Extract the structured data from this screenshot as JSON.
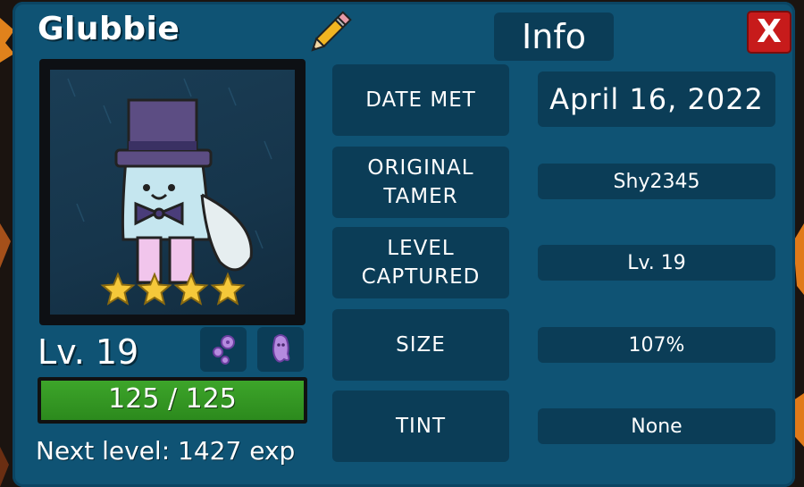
{
  "pet": {
    "name": "Glubbie",
    "level": "Lv. 19",
    "stars": 4,
    "hp": {
      "text": "125 / 125",
      "fraction": 1.0
    },
    "next_level": "Next level: 1427 exp"
  },
  "header": {
    "tab_label": "Info",
    "close_label": "X"
  },
  "fields": [
    {
      "label": "DATE MET",
      "value": "April 16, 2022"
    },
    {
      "label": "ORIGINAL\nTAMER",
      "value": "Shy2345"
    },
    {
      "label": "LEVEL\nCAPTURED",
      "value": "Lv. 19"
    },
    {
      "label": "SIZE",
      "value": "107%"
    },
    {
      "label": "TINT",
      "value": "None"
    }
  ],
  "icons": {
    "edit": "pencil-icon",
    "ability1": "bubbles-icon",
    "ability2": "ghost-icon"
  },
  "colors": {
    "panel": "#0f5374",
    "card": "#0b3d57",
    "close": "#c71b1b",
    "hp": "#3da52a",
    "star": "#f5c83a"
  }
}
